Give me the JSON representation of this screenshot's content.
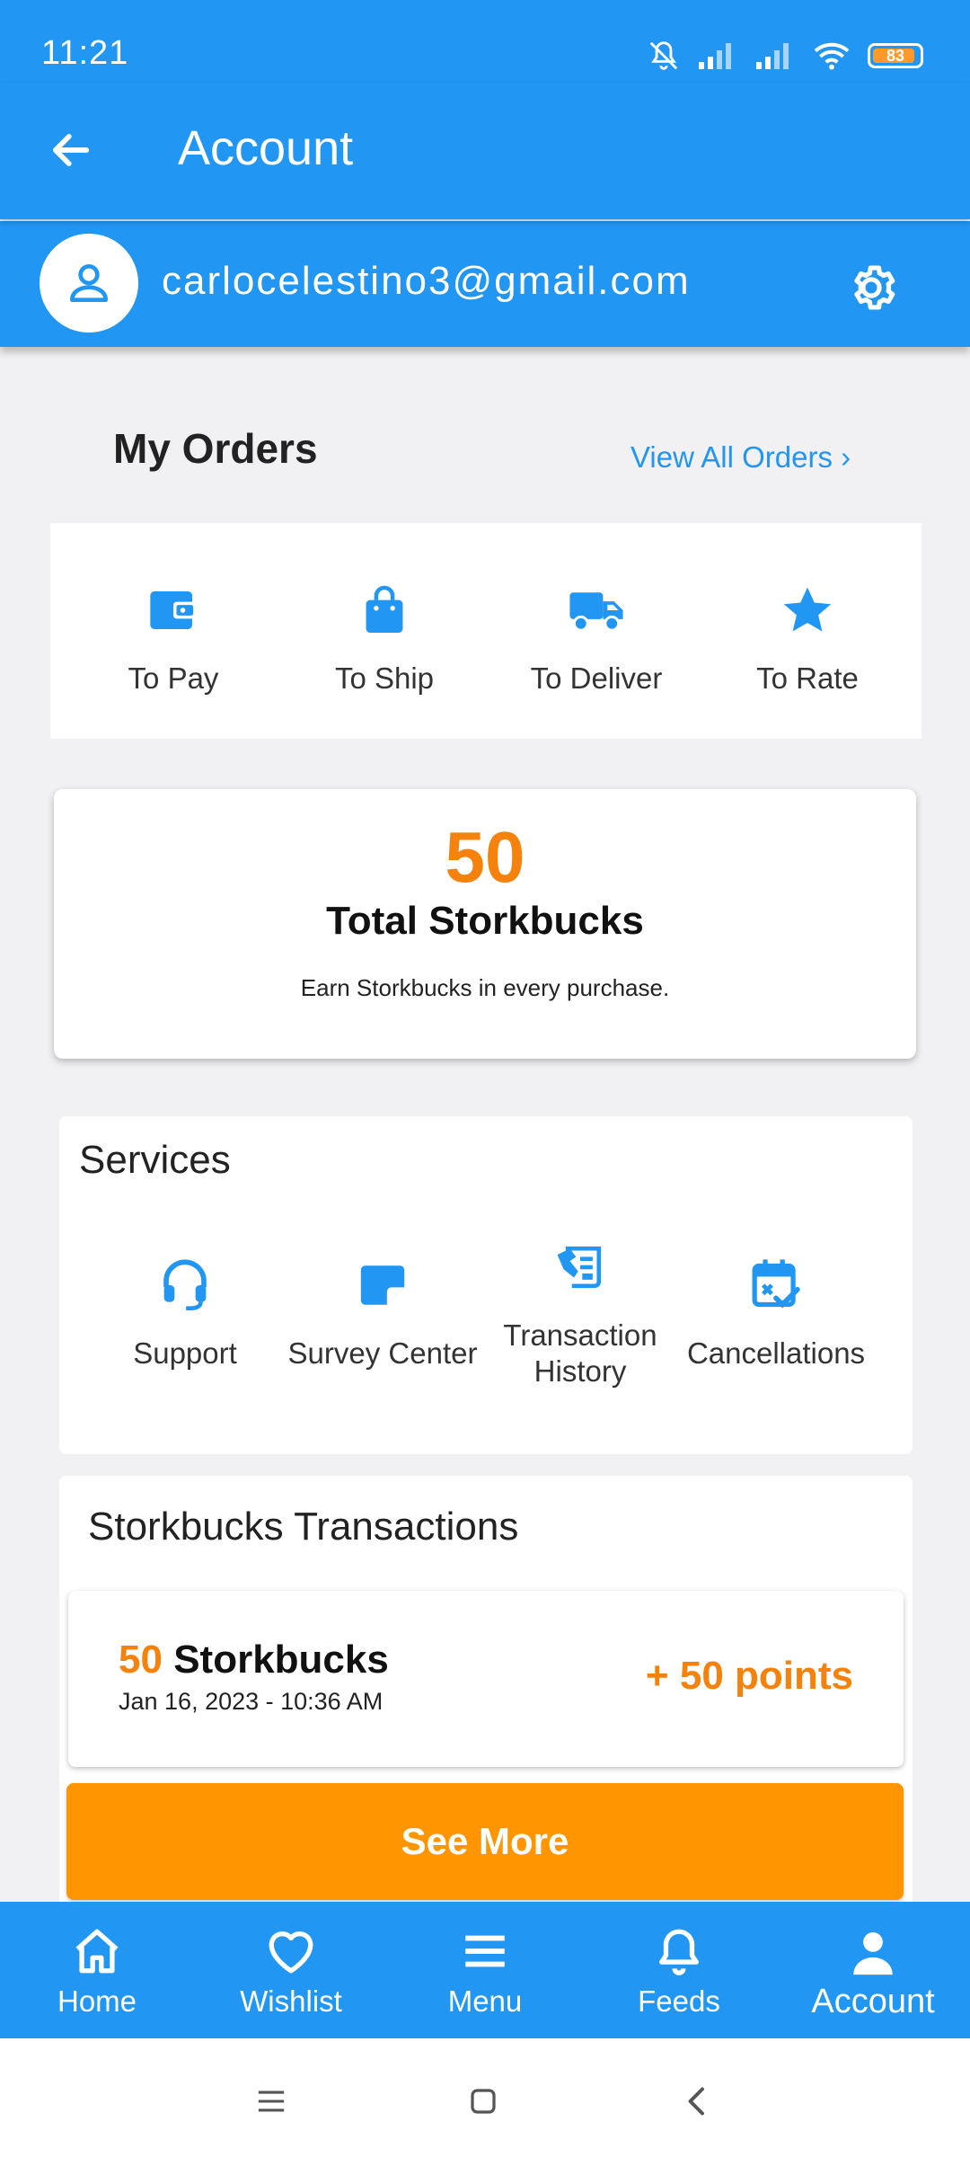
{
  "status_bar": {
    "time": "11:21",
    "battery": "83"
  },
  "appbar": {
    "title": "Account"
  },
  "profile": {
    "email": "carlocelestino3@gmail.com"
  },
  "orders": {
    "title": "My Orders",
    "view_all": "View All Orders ›",
    "items": [
      {
        "label": "To Pay",
        "icon": "wallet-icon"
      },
      {
        "label": "To Ship",
        "icon": "shopping-bag-icon"
      },
      {
        "label": "To Deliver",
        "icon": "truck-icon"
      },
      {
        "label": "To Rate",
        "icon": "star-icon"
      }
    ]
  },
  "storkbucks": {
    "total": "50",
    "title": "Total Storkbucks",
    "subtitle": "Earn Storkbucks in every purchase."
  },
  "services": {
    "title": "Services",
    "items": [
      {
        "label": "Support",
        "icon": "headset-icon"
      },
      {
        "label": "Survey Center",
        "icon": "note-icon"
      },
      {
        "label": "Transaction History",
        "icon": "receipt-icon"
      },
      {
        "label": "Cancellations",
        "icon": "calendar-check-icon"
      }
    ]
  },
  "transactions": {
    "title": "Storkbucks Transactions",
    "items": [
      {
        "amount": "50",
        "unit": "Storkbucks",
        "date": "Jan 16, 2023 - 10:36 AM",
        "points": "+ 50 points"
      }
    ],
    "see_more": "See More"
  },
  "bottom_nav": {
    "items": [
      {
        "label": "Home",
        "icon": "home-icon"
      },
      {
        "label": "Wishlist",
        "icon": "heart-icon"
      },
      {
        "label": "Menu",
        "icon": "menu-icon"
      },
      {
        "label": "Feeds",
        "icon": "bell-icon"
      },
      {
        "label": "Account",
        "icon": "person-icon"
      }
    ],
    "active": "Account"
  },
  "colors": {
    "primary": "#2196f3",
    "accent": "#f5820d",
    "button": "#ff9500"
  }
}
